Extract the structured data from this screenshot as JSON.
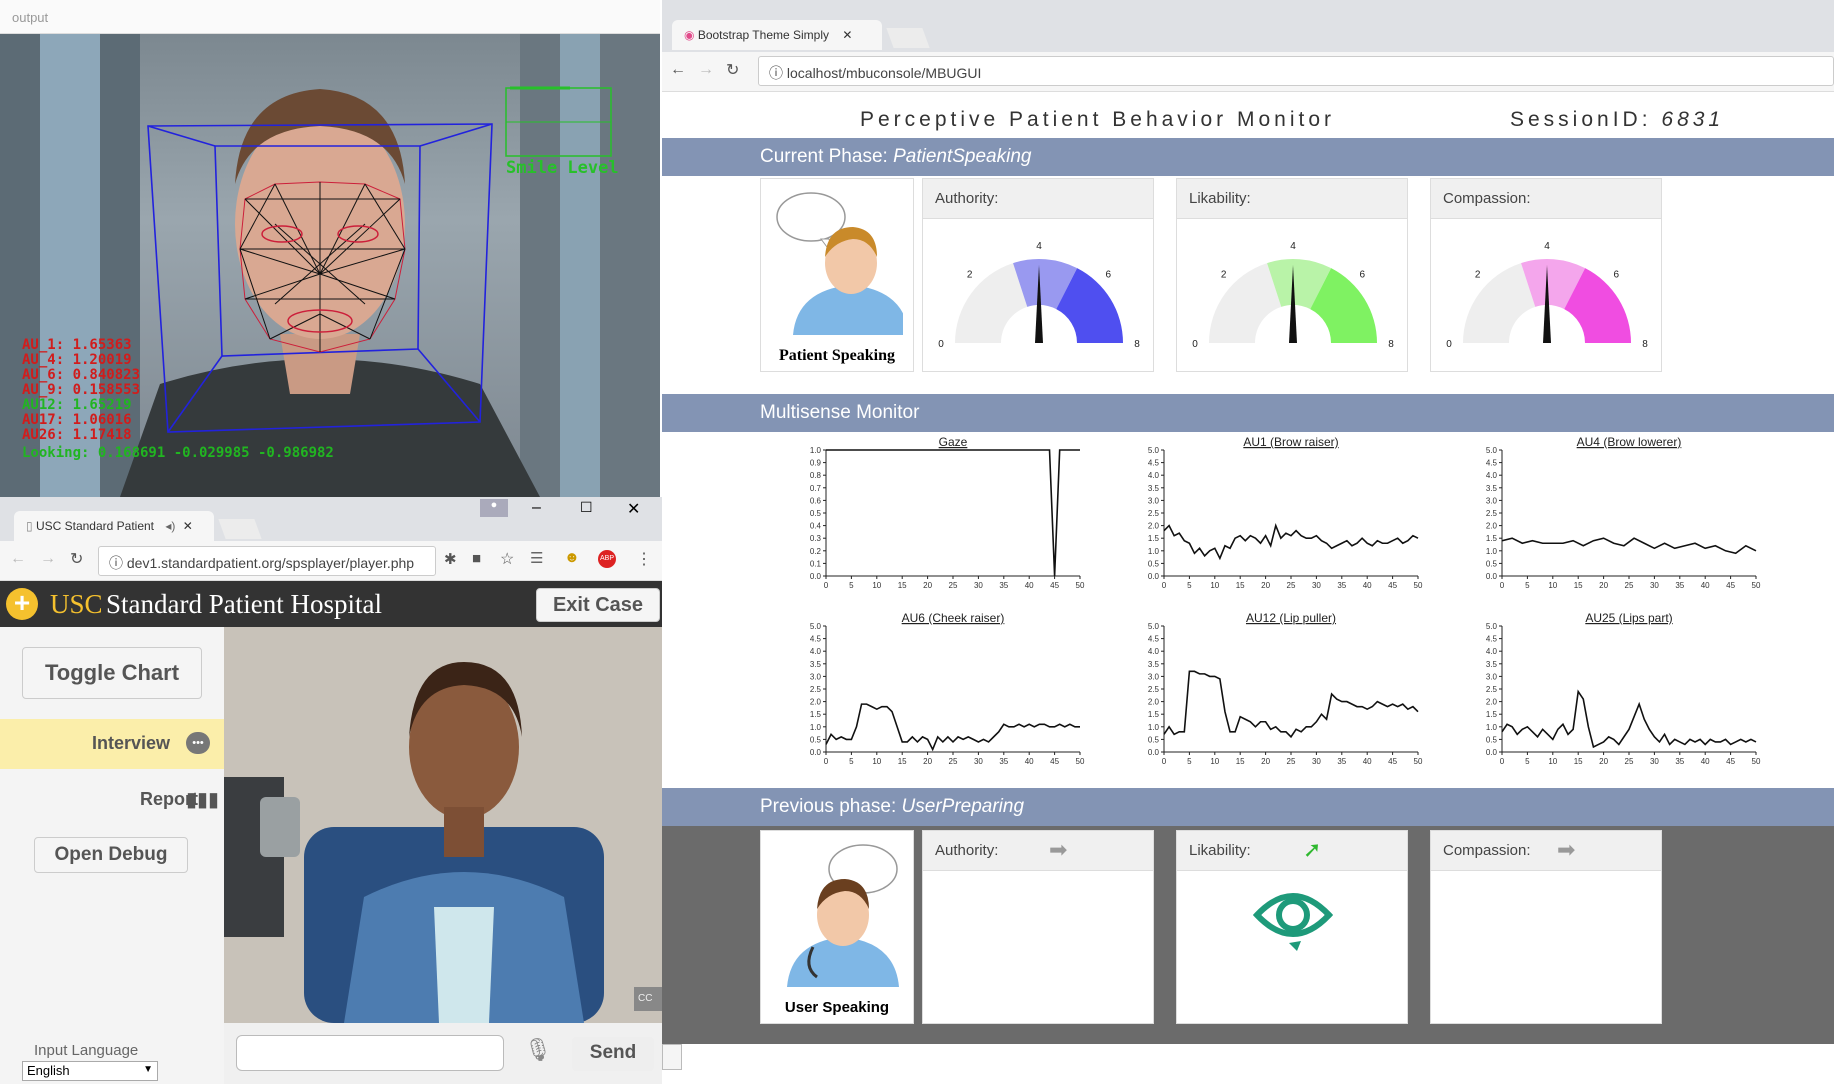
{
  "camera": {
    "window_title": "output",
    "smile_label": "Smile Level",
    "au_lines": [
      {
        "text": "AU_1: 1.65363",
        "color": "#d11c1c"
      },
      {
        "text": "AU_4: 1.20019",
        "color": "#d11c1c"
      },
      {
        "text": "AU_6: 0.840823",
        "color": "#d11c1c"
      },
      {
        "text": "AU_9: 0.158553",
        "color": "#d11c1c"
      },
      {
        "text": "AU12: 1.65219",
        "color": "#21b521"
      },
      {
        "text": "AU17: 1.06016",
        "color": "#d11c1c"
      },
      {
        "text": "AU26: 1.17418",
        "color": "#d11c1c"
      }
    ],
    "looking_text": "Looking: 0.168691 -0.029985 -0.986982"
  },
  "sp_browser": {
    "tab_title": "USC Standard Patient",
    "url": "dev1.standardpatient.org/spsplayer/player.php",
    "hospital_brand": "USC",
    "hospital_name": "Standard Patient Hospital",
    "exit_label": "Exit Case",
    "toggle_chart": "Toggle Chart",
    "interview": "Interview",
    "report": "Report",
    "open_debug": "Open Debug",
    "input_language_label": "Input Language",
    "language_value": "English",
    "send_label": "Send",
    "cc_label": "CC"
  },
  "monitor_browser": {
    "tab_title": "Bootstrap Theme Simply",
    "url": "localhost/mbuconsole/MBUGUI"
  },
  "monitor": {
    "title": "Perceptive Patient Behavior Monitor",
    "session_label": "SessionID:",
    "session_id": "6831",
    "current_phase_label": "Current Phase:",
    "current_phase": "PatientSpeaking",
    "patient_caption": "Patient Speaking",
    "gauges": [
      {
        "label": "Authority:",
        "value": 4.0,
        "color": "#4f4ff0",
        "light": "#9999f0"
      },
      {
        "label": "Likability:",
        "value": 4.0,
        "color": "#7ff262",
        "light": "#b9f3a8"
      },
      {
        "label": "Compassion:",
        "value": 4.0,
        "color": "#f04de1",
        "light": "#f4a6ec"
      }
    ],
    "gauge_ticks": [
      "0",
      "2",
      "4",
      "6",
      "8"
    ],
    "multisense_label": "Multisense Monitor",
    "previous_phase_label": "Previous phase:",
    "previous_phase": "UserPreparing",
    "user_caption": "User Speaking",
    "prev_cards": [
      {
        "label": "Authority:",
        "arrow": "➡",
        "arrow_color": "#999999"
      },
      {
        "label": "Likability:",
        "arrow": "➚",
        "arrow_color": "#2fb82f"
      },
      {
        "label": "Compassion:",
        "arrow": "➡",
        "arrow_color": "#999999"
      }
    ]
  },
  "chart_data": [
    {
      "type": "line",
      "title": "Gaze",
      "ylim": [
        0,
        1.0
      ],
      "yticks": [
        "0.0",
        "0.1",
        "0.2",
        "0.3",
        "0.4",
        "0.5",
        "0.6",
        "0.7",
        "0.8",
        "0.9",
        "1.0"
      ],
      "xlim": [
        0,
        50
      ],
      "xticks": [
        "0",
        "5",
        "10",
        "15",
        "20",
        "25",
        "30",
        "35",
        "40",
        "45",
        "50"
      ],
      "x": [
        0,
        44,
        45,
        46,
        47,
        50
      ],
      "y": [
        1.0,
        1.0,
        0.0,
        1.0,
        1.0,
        1.0
      ]
    },
    {
      "type": "line",
      "title": "AU1 (Brow raiser)",
      "ylim": [
        0,
        5.0
      ],
      "yticks": [
        "0.0",
        "0.5",
        "1.0",
        "1.5",
        "2.0",
        "2.5",
        "3.0",
        "3.5",
        "4.0",
        "4.5",
        "5.0"
      ],
      "xlim": [
        0,
        50
      ],
      "xticks": [
        "0",
        "5",
        "10",
        "15",
        "20",
        "25",
        "30",
        "35",
        "40",
        "45",
        "50"
      ],
      "x": [
        0,
        1,
        2,
        3,
        4,
        5,
        6,
        7,
        8,
        9,
        10,
        11,
        12,
        13,
        14,
        15,
        16,
        17,
        18,
        19,
        20,
        21,
        22,
        23,
        24,
        25,
        26,
        27,
        28,
        29,
        30,
        31,
        32,
        33,
        34,
        35,
        36,
        37,
        38,
        39,
        40,
        41,
        42,
        43,
        44,
        45,
        46,
        47,
        48,
        49,
        50
      ],
      "y": [
        1.8,
        2.0,
        1.6,
        1.7,
        1.4,
        1.3,
        0.9,
        1.1,
        0.8,
        1.0,
        1.1,
        0.7,
        1.2,
        1.1,
        1.5,
        1.6,
        1.4,
        1.6,
        1.5,
        1.3,
        1.6,
        1.2,
        2.0,
        1.5,
        1.7,
        1.6,
        1.8,
        1.6,
        1.5,
        1.5,
        1.6,
        1.4,
        1.3,
        1.1,
        1.2,
        1.3,
        1.4,
        1.2,
        1.3,
        1.5,
        1.3,
        1.2,
        1.4,
        1.3,
        1.3,
        1.4,
        1.5,
        1.3,
        1.4,
        1.6,
        1.5
      ]
    },
    {
      "type": "line",
      "title": "AU4 (Brow lowerer)",
      "ylim": [
        0,
        5.0
      ],
      "yticks": [
        "0.0",
        "0.5",
        "1.0",
        "1.5",
        "2.0",
        "2.5",
        "3.0",
        "3.5",
        "4.0",
        "4.5",
        "5.0"
      ],
      "xlim": [
        0,
        50
      ],
      "xticks": [
        "0",
        "5",
        "10",
        "15",
        "20",
        "25",
        "30",
        "35",
        "40",
        "45",
        "50"
      ],
      "x": [
        0,
        2,
        4,
        6,
        8,
        10,
        12,
        14,
        16,
        18,
        20,
        22,
        24,
        26,
        28,
        30,
        32,
        34,
        36,
        38,
        40,
        42,
        44,
        46,
        48,
        50
      ],
      "y": [
        1.4,
        1.5,
        1.3,
        1.4,
        1.3,
        1.3,
        1.3,
        1.4,
        1.2,
        1.4,
        1.5,
        1.3,
        1.2,
        1.5,
        1.3,
        1.1,
        1.3,
        1.1,
        1.2,
        1.3,
        1.1,
        1.2,
        1.0,
        0.9,
        1.2,
        1.0
      ]
    },
    {
      "type": "line",
      "title": "AU6 (Cheek raiser)",
      "ylim": [
        0,
        5.0
      ],
      "yticks": [
        "0.0",
        "0.5",
        "1.0",
        "1.5",
        "2.0",
        "2.5",
        "3.0",
        "3.5",
        "4.0",
        "4.5",
        "5.0"
      ],
      "xlim": [
        0,
        50
      ],
      "xticks": [
        "0",
        "5",
        "10",
        "15",
        "20",
        "25",
        "30",
        "35",
        "40",
        "45",
        "50"
      ],
      "x": [
        0,
        1,
        2,
        3,
        4,
        5,
        6,
        7,
        8,
        9,
        10,
        11,
        12,
        13,
        14,
        15,
        16,
        17,
        18,
        19,
        20,
        21,
        22,
        23,
        24,
        25,
        26,
        27,
        28,
        29,
        30,
        31,
        32,
        33,
        34,
        35,
        36,
        37,
        38,
        39,
        40,
        41,
        42,
        43,
        44,
        45,
        46,
        47,
        48,
        49,
        50
      ],
      "y": [
        0.3,
        0.7,
        0.5,
        0.6,
        0.5,
        0.5,
        1.0,
        1.9,
        1.9,
        1.8,
        1.7,
        1.8,
        1.8,
        1.6,
        1.0,
        0.4,
        0.4,
        0.6,
        0.4,
        0.6,
        0.5,
        0.1,
        0.6,
        0.4,
        0.6,
        0.4,
        0.6,
        0.5,
        0.6,
        0.5,
        0.4,
        0.5,
        0.4,
        0.6,
        0.8,
        1.1,
        1.0,
        1.0,
        1.1,
        1.0,
        1.1,
        1.0,
        1.1,
        1.1,
        1.0,
        1.0,
        1.1,
        1.0,
        1.1,
        1.0,
        1.0
      ]
    },
    {
      "type": "line",
      "title": "AU12 (Lip puller)",
      "ylim": [
        0,
        5.0
      ],
      "yticks": [
        "0.0",
        "0.5",
        "1.0",
        "1.5",
        "2.0",
        "2.5",
        "3.0",
        "3.5",
        "4.0",
        "4.5",
        "5.0"
      ],
      "xlim": [
        0,
        50
      ],
      "xticks": [
        "0",
        "5",
        "10",
        "15",
        "20",
        "25",
        "30",
        "35",
        "40",
        "45",
        "50"
      ],
      "x": [
        0,
        1,
        2,
        3,
        4,
        5,
        6,
        7,
        8,
        9,
        10,
        11,
        12,
        13,
        14,
        15,
        16,
        17,
        18,
        19,
        20,
        21,
        22,
        23,
        24,
        25,
        26,
        27,
        28,
        29,
        30,
        31,
        32,
        33,
        34,
        35,
        36,
        37,
        38,
        39,
        40,
        41,
        42,
        43,
        44,
        45,
        46,
        47,
        48,
        49,
        50
      ],
      "y": [
        0.7,
        1.0,
        0.7,
        0.8,
        0.8,
        3.2,
        3.2,
        3.1,
        3.1,
        3.0,
        3.0,
        2.9,
        1.6,
        0.8,
        0.8,
        1.4,
        1.3,
        1.2,
        1.0,
        1.2,
        1.2,
        0.9,
        1.0,
        0.8,
        0.8,
        0.6,
        0.9,
        0.8,
        1.0,
        1.0,
        1.2,
        1.5,
        1.3,
        2.3,
        2.1,
        2.0,
        2.0,
        1.9,
        1.8,
        1.8,
        1.7,
        1.8,
        2.0,
        1.9,
        1.8,
        1.9,
        1.8,
        1.9,
        1.7,
        1.8,
        1.6
      ]
    },
    {
      "type": "line",
      "title": "AU25 (Lips part)",
      "ylim": [
        0,
        5.0
      ],
      "yticks": [
        "0.0",
        "0.5",
        "1.0",
        "1.5",
        "2.0",
        "2.5",
        "3.0",
        "3.5",
        "4.0",
        "4.5",
        "5.0"
      ],
      "xlim": [
        0,
        50
      ],
      "xticks": [
        "0",
        "5",
        "10",
        "15",
        "20",
        "25",
        "30",
        "35",
        "40",
        "45",
        "50"
      ],
      "x": [
        0,
        1,
        2,
        3,
        4,
        5,
        6,
        7,
        8,
        9,
        10,
        11,
        12,
        13,
        14,
        15,
        16,
        17,
        18,
        19,
        20,
        21,
        22,
        23,
        24,
        25,
        26,
        27,
        28,
        29,
        30,
        31,
        32,
        33,
        34,
        35,
        36,
        37,
        38,
        39,
        40,
        41,
        42,
        43,
        44,
        45,
        46,
        47,
        48,
        49,
        50
      ],
      "y": [
        0.8,
        1.1,
        1.0,
        0.7,
        0.9,
        1.0,
        0.8,
        0.6,
        0.9,
        0.7,
        0.5,
        0.9,
        1.1,
        0.7,
        0.9,
        2.4,
        2.1,
        1.0,
        0.2,
        0.3,
        0.4,
        0.6,
        0.5,
        0.3,
        0.6,
        0.9,
        1.4,
        1.9,
        1.3,
        0.9,
        0.6,
        0.4,
        0.7,
        0.3,
        0.5,
        0.4,
        0.3,
        0.5,
        0.4,
        0.5,
        0.3,
        0.5,
        0.4,
        0.4,
        0.5,
        0.3,
        0.4,
        0.5,
        0.4,
        0.5,
        0.4
      ]
    }
  ]
}
